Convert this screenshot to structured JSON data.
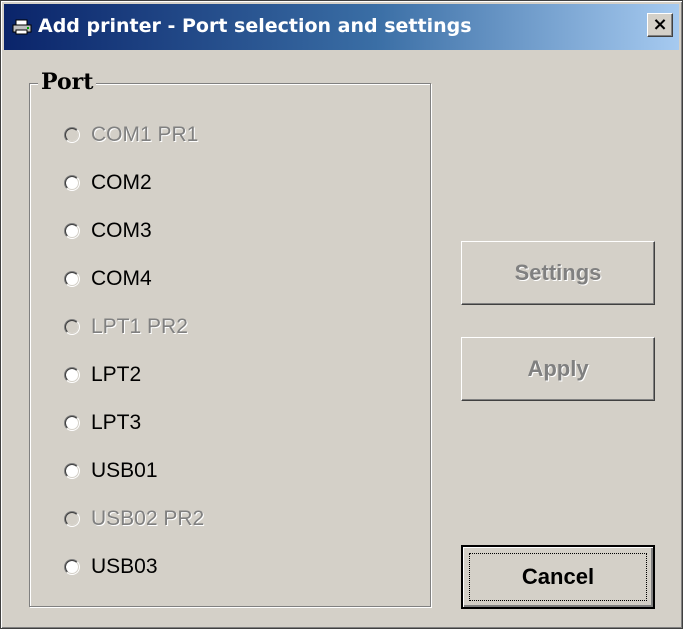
{
  "window": {
    "title": "Add printer - Port selection and settings",
    "icon": "printer-icon",
    "close_glyph": "×"
  },
  "port_group": {
    "label": "Port",
    "options": [
      {
        "label": "COM1  PR1",
        "enabled": false,
        "selected": false
      },
      {
        "label": "COM2",
        "enabled": true,
        "selected": false
      },
      {
        "label": "COM3",
        "enabled": true,
        "selected": false
      },
      {
        "label": "COM4",
        "enabled": true,
        "selected": false
      },
      {
        "label": "LPT1  PR2",
        "enabled": false,
        "selected": false
      },
      {
        "label": "LPT2",
        "enabled": true,
        "selected": false
      },
      {
        "label": "LPT3",
        "enabled": true,
        "selected": false
      },
      {
        "label": "USB01",
        "enabled": true,
        "selected": false
      },
      {
        "label": "USB02  PR2",
        "enabled": false,
        "selected": false
      },
      {
        "label": "USB03",
        "enabled": true,
        "selected": false
      }
    ]
  },
  "buttons": {
    "settings": {
      "label": "Settings",
      "enabled": false
    },
    "apply": {
      "label": "Apply",
      "enabled": false
    },
    "cancel": {
      "label": "Cancel",
      "enabled": true
    }
  },
  "colors": {
    "face": "#d4d0c8",
    "title_start": "#0a246a",
    "title_end": "#a6caf0",
    "disabled_text": "#808080"
  }
}
